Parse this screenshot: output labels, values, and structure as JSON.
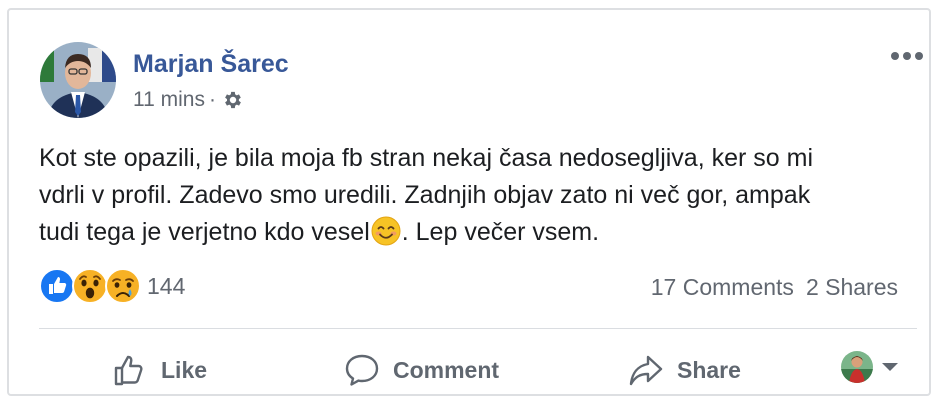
{
  "post": {
    "author": "Marjan Šarec",
    "timestamp": "11 mins",
    "separator": "·",
    "privacy_icon": "gear-icon",
    "more_icon": "more-options-icon",
    "text_lines": [
      "Kot ste opazili, je bila moja fb stran nekaj časa nedosegljiva, ker so mi",
      "vdrli v profil. Zadevo smo uredili. Zadnjih objav zato ni več gor, ampak",
      "tudi tega je verjetno kdo vesel"
    ],
    "text_tail": ". Lep večer vsem.",
    "inline_emoji": "smiling-face-emoji"
  },
  "reactions": {
    "icons": [
      "like-reaction-icon",
      "wow-reaction-icon",
      "sad-reaction-icon"
    ],
    "count": "144"
  },
  "stats": {
    "comments": "17 Comments",
    "shares": "2 Shares"
  },
  "actions": {
    "like": "Like",
    "comment": "Comment",
    "share": "Share"
  },
  "colors": {
    "author_link": "#385898",
    "secondary_text": "#616770",
    "action_text": "#606770",
    "like_blue": "#1877f2",
    "reaction_yellow": "#f7b125",
    "divider": "#dadde1",
    "card_border": "#dddfe2"
  }
}
